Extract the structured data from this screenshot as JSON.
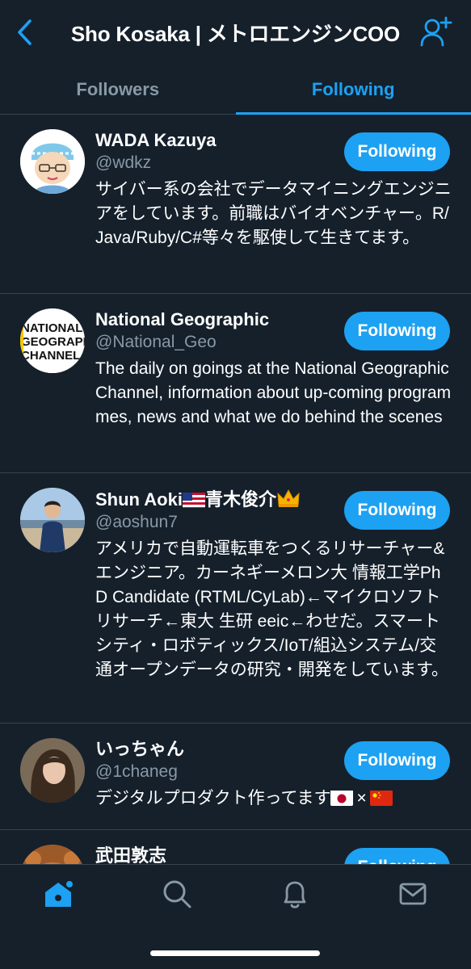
{
  "header": {
    "title": "Sho Kosaka | メトロエンジンCOO",
    "back_icon": "chevron-left-icon",
    "add_user_icon": "add-user-icon",
    "accent_color": "#1da1f2"
  },
  "tabs": [
    {
      "label": "Followers",
      "active": false
    },
    {
      "label": "Following",
      "active": true
    }
  ],
  "users": [
    {
      "name": "WADA Kazuya",
      "handle": "@wdkz",
      "bio": "サイバー系の会社でデータマイニングエンジニアをしています。前職はバイオベンチャー。R/Java/Ruby/C#等々を駆使して生きてます。",
      "button": "Following"
    },
    {
      "name": "National Geographic",
      "handle": "@National_Geo",
      "avatar_text": [
        "NATIONAL",
        "GEOGRAPHIC",
        "CHANNEL"
      ],
      "bio": "The daily on goings at the National Geographic Channel, information about up-coming programmes, news and what we do behind the scenes",
      "button": "Following"
    },
    {
      "name_prefix": "Shun Aoki",
      "name_middle": "青木俊介",
      "handle": "@aoshun7",
      "bio": "アメリカで自動運転車をつくるリサーチャー&エンジニア。カーネギーメロン大 情報工学PhD Candidate (RTML/CyLab)←マイクロソフトリサーチ←東大 生研 eeic←わせだ。スマートシティ・ロボティックス/IoT/組込システム/交通オープンデータの研究・開発をしています。",
      "button": "Following"
    },
    {
      "name": "いっちゃん",
      "handle": "@1chaneg",
      "bio_text": "デジタルプロダクト作ってます",
      "bio_separator": "×",
      "button": "Following"
    },
    {
      "name": "武田敦志",
      "button": "Following"
    }
  ],
  "tabbar": {
    "items": [
      {
        "icon": "home-icon",
        "active": true
      },
      {
        "icon": "search-icon",
        "active": false
      },
      {
        "icon": "notifications-icon",
        "active": false
      },
      {
        "icon": "messages-icon",
        "active": false
      }
    ]
  }
}
